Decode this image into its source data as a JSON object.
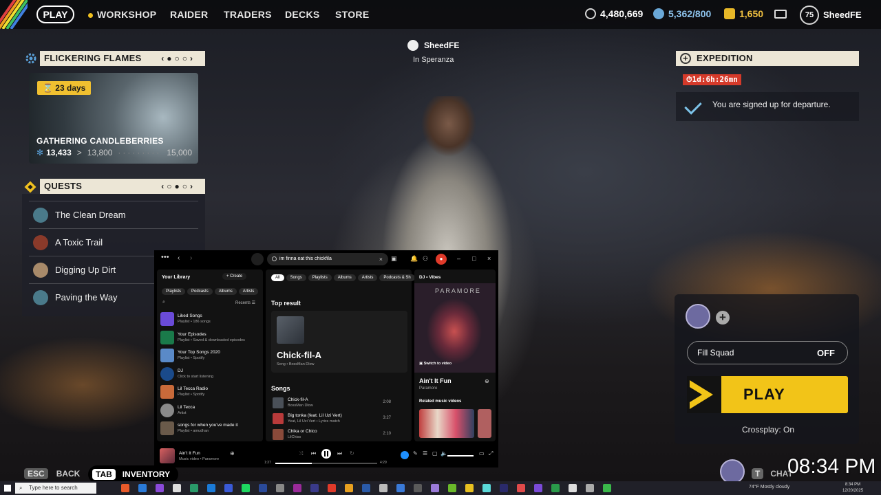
{
  "top_nav": {
    "play": "PLAY",
    "workshop": "WORKSHOP",
    "raider": "RAIDER",
    "traders": "TRADERS",
    "decks": "DECKS",
    "store": "STORE"
  },
  "currencies": {
    "coins": "4,480,669",
    "credits": "5,362/800",
    "raider_tokens": "1,650",
    "coin_color": "#d8d8d8",
    "credits_color": "#6aa8d8",
    "tokens_color": "#e8b828"
  },
  "profile": {
    "level": "75",
    "name": "SheedFE"
  },
  "event": {
    "title": "FLICKERING FLAMES",
    "days_remaining": "23",
    "days_unit": "days",
    "task": "GATHERING CANDLEBERRIES",
    "current": "13,433",
    "next_tier": "13,800",
    "max_tier": "15,000",
    "progress_arrow": ">"
  },
  "quests": {
    "title": "QUESTS",
    "items": [
      {
        "label": "The Clean Dream"
      },
      {
        "label": "A Toxic Trail"
      },
      {
        "label": "Digging Up Dirt"
      },
      {
        "label": "Paving the Way"
      }
    ]
  },
  "pager_arrows": {
    "prev": "‹",
    "next": "›"
  },
  "player": {
    "name": "SheedFE",
    "location": "In Speranza"
  },
  "expedition": {
    "title": "EXPEDITION",
    "timer": "1d:6h:26mn",
    "status": "You are signed up for departure."
  },
  "squad": {
    "fill_label": "Fill Squad",
    "fill_value": "OFF",
    "play_label": "PLAY",
    "crossplay": "Crossplay: On"
  },
  "bottom": {
    "esc_key": "ESC",
    "back_label": "BACK",
    "tab_key": "TAB",
    "inventory_label": "INVENTORY",
    "chat_key": "T",
    "chat_label": "CHAT",
    "clock": "08:34 PM"
  },
  "spotify": {
    "search_query": "im finna eat this chickfila",
    "library_title": "Your Library",
    "create_label": "Create",
    "library_chips": [
      "Playlists",
      "Podcasts",
      "Albums",
      "Artists"
    ],
    "recents_label": "Recents",
    "library_items": [
      {
        "name": "Liked Songs",
        "sub": "Playlist • 186 songs",
        "color": "#6a4bd8"
      },
      {
        "name": "Your Episodes",
        "sub": "Playlist • Saved & downloaded episodes",
        "color": "#1a7a4a"
      },
      {
        "name": "Your Top Songs 2020",
        "sub": "Playlist • Spotify",
        "color": "#5a8ac8"
      },
      {
        "name": "DJ",
        "sub": "Click to start listening",
        "color": "#1a4a8a"
      },
      {
        "name": "Lil Tecca Radio",
        "sub": "Playlist • Spotify",
        "color": "#c86a3a"
      },
      {
        "name": "Lil Tecca",
        "sub": "Artist",
        "color": "#8a8a8a"
      },
      {
        "name": "songs for when you've made it",
        "sub": "Playlist • amudhan",
        "color": "#6a5a4a"
      }
    ],
    "filter_chips": [
      "All",
      "Songs",
      "Playlists",
      "Albums",
      "Artists",
      "Podcasts & Sh"
    ],
    "top_result_heading": "Top result",
    "top_result_name": "Chick-fil-A",
    "top_result_sub": "Song • BossMan Dlow",
    "songs_heading": "Songs",
    "songs": [
      {
        "name": "Chick-fil-A",
        "sub": "BossMan Dlow",
        "duration": "2:08",
        "color": "#4a5058"
      },
      {
        "name": "Big tonka (feat. Lil Uzi Vert)",
        "sub": "Yeat, Lil Uzi Vert • Lyrics match",
        "duration": "3:27",
        "color": "#b83a3a"
      },
      {
        "name": "Chika or Chico",
        "sub": "LilChiss",
        "duration": "2:10",
        "color": "#8a4a3a"
      }
    ],
    "now_playing_panel_title": "DJ • Vibes",
    "artwork_brand": "PARAMORE",
    "switch_video": "Switch to video",
    "now_playing_song": "Ain't It Fun",
    "now_playing_artist": "Paramore",
    "related_heading": "Related music videos",
    "player_song": "Ain't It Fun",
    "player_sub": "Music video • Paramore",
    "elapsed": "1:37",
    "total": "4:29",
    "progress_fraction": 0.36,
    "accent": "#1ed760"
  },
  "taskbar": {
    "search_placeholder": "Type here to search",
    "weather": "74°F  Mostly cloudy",
    "time": "8:34 PM",
    "date": "12/20/2025"
  }
}
